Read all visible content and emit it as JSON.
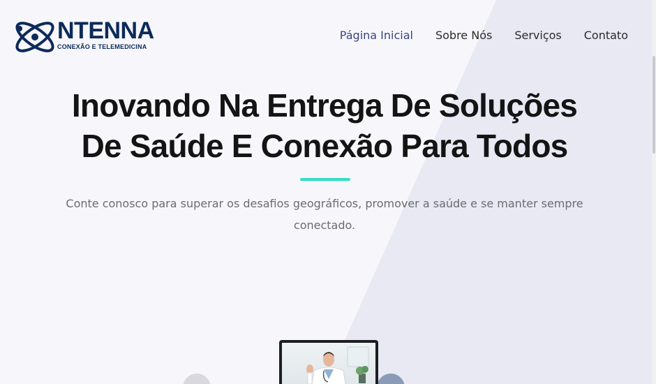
{
  "brand": {
    "logo_word": "NTENNA",
    "tagline": "CONEXÃO E TELEMEDICINA",
    "color": "#0c2a5a"
  },
  "nav": {
    "items": [
      {
        "label": "Página Inicial",
        "active": true
      },
      {
        "label": "Sobre Nós",
        "active": false
      },
      {
        "label": "Serviços",
        "active": false
      },
      {
        "label": "Contato",
        "active": false
      }
    ]
  },
  "hero": {
    "title_line1": "Inovando Na Entrega De Soluções",
    "title_line2": "De Saúde E Conexão Para Todos",
    "subtitle_line1": "Conte conosco para superar os desafios geográficos, promover a saúde e se manter sempre",
    "subtitle_line2": "conectado.",
    "accent_color": "#2fe0c2"
  },
  "media": {
    "laptop_image": "doctor-video-call-icon"
  }
}
